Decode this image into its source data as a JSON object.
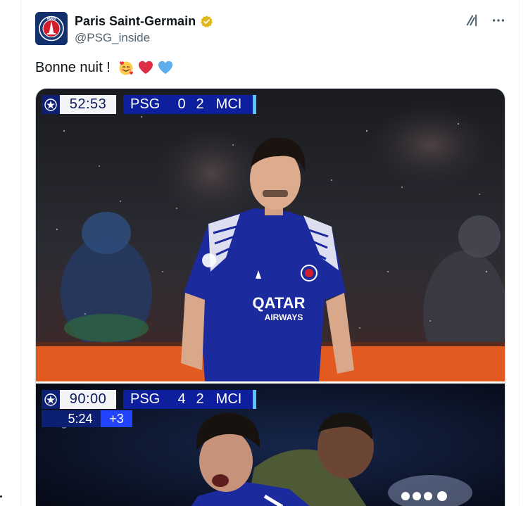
{
  "author": {
    "display_name": "Paris Saint-Germain",
    "handle": "@PSG_inside",
    "avatar_label": "PARIS"
  },
  "tweet": {
    "text": "Bonne nuit !",
    "emojis": [
      "smiling-face-with-hearts",
      "red-heart",
      "blue-heart"
    ]
  },
  "colors": {
    "psg_navy": "#12306b",
    "verified_gold": "#e2b719",
    "bug_blue": "#0d1f9c",
    "bug_cyan": "#55c6ff"
  },
  "media": {
    "photo_1": {
      "clock": "52:53",
      "home": "PSG",
      "home_score": "0",
      "away_score": "2",
      "away": "MCI",
      "jersey_sponsor": "QATAR",
      "jersey_sponsor_sub": "AIRWAYS"
    },
    "photo_2": {
      "clock": "90:00",
      "home": "PSG",
      "home_score": "4",
      "away_score": "2",
      "away": "MCI",
      "elapsed": "5:24",
      "added_time": "+3"
    }
  }
}
